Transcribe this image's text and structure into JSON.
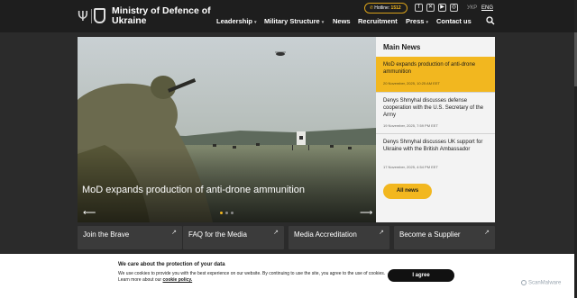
{
  "header": {
    "site_title": "Ministry of Defence of Ukraine",
    "hotline_label": "Hotline:",
    "hotline_number": "1512",
    "languages": [
      "УКР",
      "ENG"
    ],
    "active_language": "ENG",
    "social": [
      "facebook-icon",
      "x-icon",
      "youtube-icon",
      "instagram-icon"
    ]
  },
  "nav": {
    "items": [
      {
        "label": "Leadership",
        "dropdown": true
      },
      {
        "label": "Military Structure",
        "dropdown": true
      },
      {
        "label": "News",
        "dropdown": false
      },
      {
        "label": "Recruitment",
        "dropdown": false
      },
      {
        "label": "Press",
        "dropdown": true
      },
      {
        "label": "Contact us",
        "dropdown": false
      }
    ]
  },
  "hero": {
    "title": "MoD expands production of anti-drone ammunition",
    "slides": 3,
    "active_slide": 1
  },
  "news": {
    "heading": "Main News",
    "items": [
      {
        "title": "MoD expands production of anti-drone ammunition",
        "date": "20 November, 2025, 10:25 AM EET"
      },
      {
        "title": "Denys Shmyhal discusses defense cooperation with the U.S. Secretary of the Army",
        "date": "19 November, 2025, 7:59 PM EET"
      },
      {
        "title": "Denys Shmyhal discusses UK support for Ukraine with the British Ambassador",
        "date": "17 November, 2025, 4:54 PM EET"
      }
    ],
    "all_news_label": "All news"
  },
  "quick_links": [
    {
      "label": "Join the Brave"
    },
    {
      "label": "FAQ for the Media"
    },
    {
      "label": "Media Accreditation"
    },
    {
      "label": "Become a Supplier"
    }
  ],
  "cookie": {
    "title": "We care about the protection of your data",
    "text": "We use cookies to provide you with the best experience on our website. By continuing to use the site, you agree to the use of cookies. Learn more about our",
    "link": "cookie policy.",
    "agree_label": "I agree"
  },
  "watermark": "ScanMalware",
  "colors": {
    "accent": "#f2b71f",
    "header_bg": "#1e1e1e",
    "page_bg": "#2b2b2b"
  }
}
